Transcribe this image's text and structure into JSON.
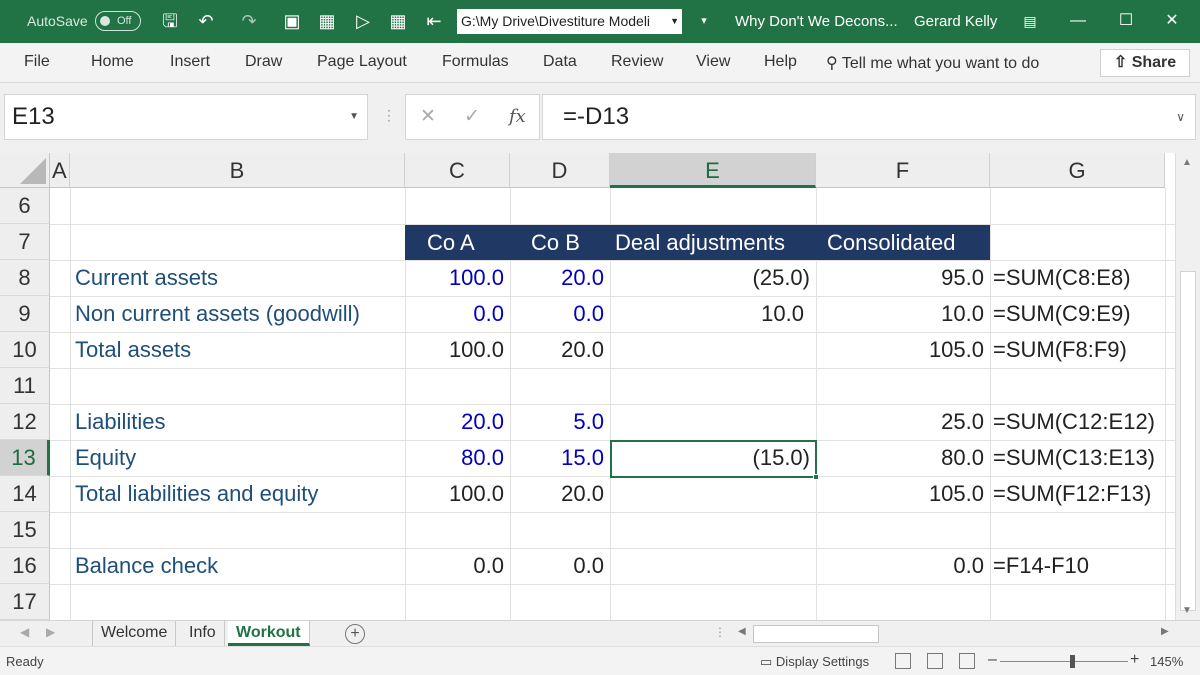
{
  "titlebar": {
    "autosave_label": "AutoSave",
    "autosave_state": "Off",
    "path": "G:\\My Drive\\Divestiture Modeli",
    "doc_name": "Why Don't We Decons...",
    "user": "Gerard Kelly"
  },
  "ribbon": {
    "tabs": [
      "File",
      "Home",
      "Insert",
      "Draw",
      "Page Layout",
      "Formulas",
      "Data",
      "Review",
      "View",
      "Help"
    ],
    "tell_me": "Tell me what you want to do",
    "share": "Share"
  },
  "formula_bar": {
    "name_box": "E13",
    "fx": "fx",
    "formula": "=-D13"
  },
  "columns": [
    "A",
    "B",
    "C",
    "D",
    "E",
    "F",
    "G"
  ],
  "rows": [
    "6",
    "7",
    "8",
    "9",
    "10",
    "11",
    "12",
    "13",
    "14",
    "15",
    "16",
    "17"
  ],
  "header": {
    "co_a": "Co A",
    "co_b": "Co B",
    "deal": "Deal adjustments",
    "consolidated": "Consolidated"
  },
  "table": {
    "r8": {
      "label": "Current assets",
      "c": "100.0",
      "d": "20.0",
      "e": "(25.0)",
      "f": "95.0",
      "g": "=SUM(C8:E8)"
    },
    "r9": {
      "label": "Non current assets (goodwill)",
      "c": "0.0",
      "d": "0.0",
      "e": "10.0",
      "f": "10.0",
      "g": "=SUM(C9:E9)"
    },
    "r10": {
      "label": "Total assets",
      "c": "100.0",
      "d": "20.0",
      "e": "",
      "f": "105.0",
      "g": "=SUM(F8:F9)"
    },
    "r12": {
      "label": "Liabilities",
      "c": "20.0",
      "d": "5.0",
      "e": "",
      "f": "25.0",
      "g": "=SUM(C12:E12)"
    },
    "r13": {
      "label": "Equity",
      "c": "80.0",
      "d": "15.0",
      "e": "(15.0)",
      "f": "80.0",
      "g": "=SUM(C13:E13)"
    },
    "r14": {
      "label": "Total liabilities and equity",
      "c": "100.0",
      "d": "20.0",
      "e": "",
      "f": "105.0",
      "g": "=SUM(F12:F13)"
    },
    "r16": {
      "label": "Balance check",
      "c": "0.0",
      "d": "0.0",
      "e": "",
      "f": "0.0",
      "g": "=F14-F10"
    }
  },
  "sheets": [
    "Welcome",
    "Info",
    "Workout"
  ],
  "active_sheet": "Workout",
  "status": {
    "ready": "Ready",
    "display_settings": "Display Settings",
    "zoom": "145%"
  }
}
